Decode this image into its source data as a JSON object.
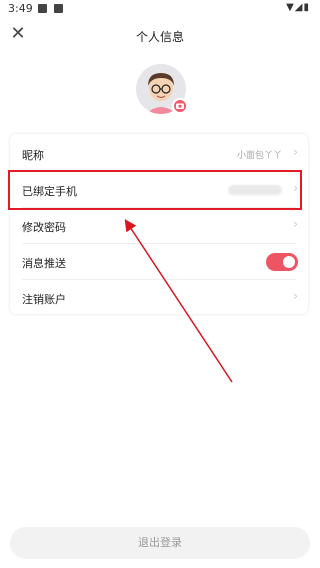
{
  "status_bar": {
    "time": "3:49"
  },
  "header": {
    "title": "个人信息"
  },
  "rows": [
    {
      "label": "昵称",
      "value": "小面包丫丫"
    },
    {
      "label": "已绑定手机",
      "value": ""
    },
    {
      "label": "修改密码",
      "value": ""
    },
    {
      "label": "消息推送",
      "value": ""
    },
    {
      "label": "注销账户",
      "value": ""
    }
  ],
  "push_enabled": true,
  "logout_label": "退出登录",
  "colors": {
    "accent": "#ee5564",
    "highlight": "#e21a24"
  },
  "icons": {
    "close": "close-icon",
    "chevron": "chevron-right-icon",
    "camera": "camera-icon"
  }
}
